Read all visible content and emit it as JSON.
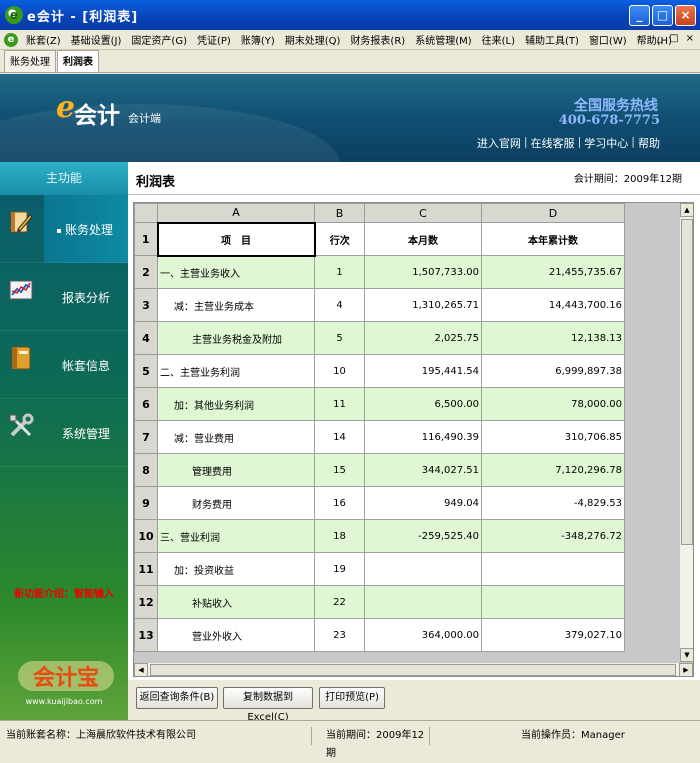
{
  "window": {
    "title": "e会计 - [利润表]",
    "app_icon": "e",
    "buttons": [
      "_",
      "□",
      "×"
    ]
  },
  "menubar": {
    "items": [
      "账套(Z)",
      "基础设置(J)",
      "固定资产(G)",
      "凭证(P)",
      "账簿(Y)",
      "期末处理(Q)",
      "财务报表(R)",
      "系统管理(M)",
      "往来(L)",
      "辅助工具(T)",
      "窗口(W)",
      "帮助(H)"
    ],
    "mdi_buttons": [
      "_",
      "□",
      "×"
    ]
  },
  "tabs": [
    {
      "label": "账务处理",
      "active": false
    },
    {
      "label": "利润表",
      "active": true
    }
  ],
  "banner": {
    "logo_e": "e",
    "logo_text": "会计",
    "logo_sub": "会计端",
    "hotline_title": "全国服务热线",
    "hotline_number": "400-678-7775",
    "links": [
      "进入官网",
      "在线客服",
      "学习中心",
      "帮助"
    ],
    "link_sep": "|"
  },
  "sidebar": {
    "header": "主功能",
    "items": [
      {
        "label": "账务处理",
        "icon": "pencil-book-icon",
        "active": true
      },
      {
        "label": "报表分析",
        "icon": "chart-icon",
        "active": false
      },
      {
        "label": "帐套信息",
        "icon": "book-icon",
        "active": false
      },
      {
        "label": "系统管理",
        "icon": "tools-icon",
        "active": false
      }
    ],
    "intro": "新功能介绍：智能输入",
    "logo_text": "会计宝",
    "logo_url": "www.kuaijibao.com"
  },
  "report": {
    "title": "利润表",
    "period": "会计期间：2009年12期",
    "col_letters": [
      "A",
      "B",
      "C",
      "D"
    ],
    "col_headers": [
      "项　目",
      "行次",
      "本月数",
      "本年累计数"
    ],
    "rows": [
      {
        "no": "2",
        "item": "一、主营业务收入",
        "line": "1",
        "month": "1,507,733.00",
        "year": "21,455,735.67",
        "indent": 0
      },
      {
        "no": "3",
        "item": "减：主营业务成本",
        "line": "4",
        "month": "1,310,265.71",
        "year": "14,443,700.16",
        "indent": 1
      },
      {
        "no": "4",
        "item": "主营业务税金及附加",
        "line": "5",
        "month": "2,025.75",
        "year": "12,138.13",
        "indent": 2
      },
      {
        "no": "5",
        "item": "二、主营业务利润",
        "line": "10",
        "month": "195,441.54",
        "year": "6,999,897.38",
        "indent": 0
      },
      {
        "no": "6",
        "item": "加：其他业务利润",
        "line": "11",
        "month": "6,500.00",
        "year": "78,000.00",
        "indent": 1
      },
      {
        "no": "7",
        "item": "减：营业费用",
        "line": "14",
        "month": "116,490.39",
        "year": "310,706.85",
        "indent": 1
      },
      {
        "no": "8",
        "item": "管理费用",
        "line": "15",
        "month": "344,027.51",
        "year": "7,120,296.78",
        "indent": 2
      },
      {
        "no": "9",
        "item": "财务费用",
        "line": "16",
        "month": "949.04",
        "year": "-4,829.53",
        "indent": 2
      },
      {
        "no": "10",
        "item": "三、营业利润",
        "line": "18",
        "month": "-259,525.40",
        "year": "-348,276.72",
        "indent": 0
      },
      {
        "no": "11",
        "item": "加：投资收益",
        "line": "19",
        "month": "",
        "year": "",
        "indent": 1
      },
      {
        "no": "12",
        "item": "补贴收入",
        "line": "22",
        "month": "",
        "year": "",
        "indent": 2
      },
      {
        "no": "13",
        "item": "营业外收入",
        "line": "23",
        "month": "364,000.00",
        "year": "379,027.10",
        "indent": 2
      }
    ],
    "header_row_no": "1"
  },
  "buttons": {
    "back": "返回查询条件(B)",
    "copy": "复制数据到Excel(C)",
    "print": "打印预览(P)"
  },
  "statusbar": {
    "company": "当前账套名称：上海晨欣软件技术有限公司",
    "period": "当前期间：2009年12期",
    "operator": "当前操作员：Manager"
  },
  "colors": {
    "title_blue": "#0842b8",
    "row_green": "#dff7d2",
    "sidebar_teal": "#0a5c70",
    "intro_red": "#ee0000"
  }
}
